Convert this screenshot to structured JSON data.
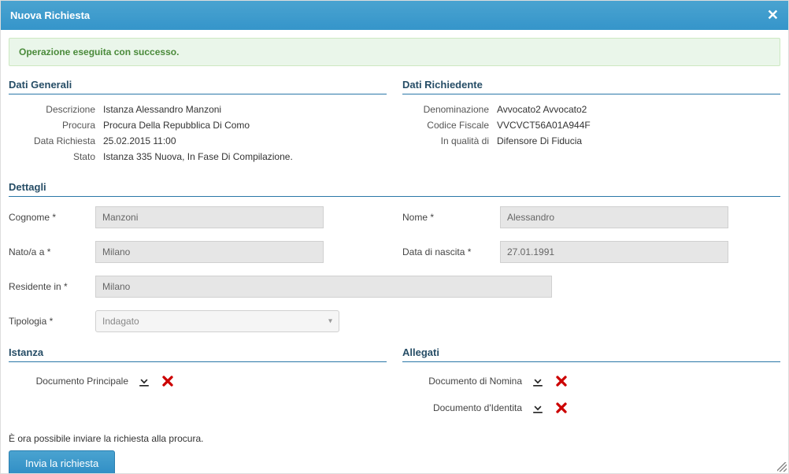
{
  "modal": {
    "title": "Nuova Richiesta"
  },
  "alert": {
    "text": "Operazione eseguita con successo."
  },
  "sections": {
    "dati_generali": {
      "title": "Dati Generali",
      "rows": {
        "descrizione": {
          "label": "Descrizione",
          "value": "Istanza Alessandro Manzoni"
        },
        "procura": {
          "label": "Procura",
          "value": "Procura Della Repubblica Di Como"
        },
        "data_richiesta": {
          "label": "Data Richiesta",
          "value": "25.02.2015 11:00"
        },
        "stato": {
          "label": "Stato",
          "value": "Istanza 335 Nuova, In Fase Di Compilazione."
        }
      }
    },
    "dati_richiedente": {
      "title": "Dati Richiedente",
      "rows": {
        "denominazione": {
          "label": "Denominazione",
          "value": "Avvocato2 Avvocato2"
        },
        "codice_fiscale": {
          "label": "Codice Fiscale",
          "value": "VVCVCT56A01A944F"
        },
        "in_qualita_di": {
          "label": "In qualità di",
          "value": "Difensore Di Fiducia"
        }
      }
    },
    "dettagli": {
      "title": "Dettagli",
      "fields": {
        "cognome": {
          "label": "Cognome *",
          "value": "Manzoni"
        },
        "nome": {
          "label": "Nome *",
          "value": "Alessandro"
        },
        "nato_a": {
          "label": "Nato/a a *",
          "value": "Milano"
        },
        "data_nascita": {
          "label": "Data di nascita *",
          "value": "27.01.1991"
        },
        "residente_in": {
          "label": "Residente in *",
          "value": "Milano"
        },
        "tipologia": {
          "label": "Tipologia *",
          "selected": "Indagato"
        }
      }
    },
    "istanza": {
      "title": "Istanza",
      "docs": {
        "principale": {
          "label": "Documento Principale"
        }
      }
    },
    "allegati": {
      "title": "Allegati",
      "docs": {
        "nomina": {
          "label": "Documento di Nomina"
        },
        "identita": {
          "label": "Documento d'Identita"
        }
      }
    }
  },
  "footer": {
    "hint": "È ora possibile inviare la richiesta alla procura.",
    "submit": "Invia la richiesta"
  },
  "icons": {
    "download": "download-icon",
    "delete": "delete-icon",
    "close": "close-icon"
  }
}
